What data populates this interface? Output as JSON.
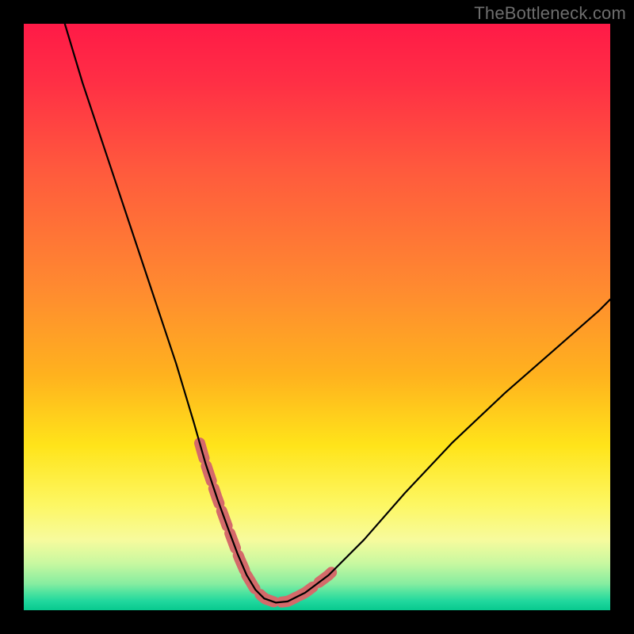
{
  "watermark": {
    "text": "TheBottleneck.com"
  },
  "gradient_stops": [
    "#ff1a47",
    "#ff2f45",
    "#ff5a3d",
    "#ff8a30",
    "#ffb21e",
    "#ffe41a",
    "#fdf763",
    "#f7fb9d",
    "#c8f8a0",
    "#86eda0",
    "#4fe39f",
    "#1fd79d",
    "#08c98e"
  ],
  "chart_data": {
    "type": "line",
    "title": "",
    "xlabel": "",
    "ylabel": "",
    "xlim": [
      0,
      100
    ],
    "ylim": [
      0,
      100
    ],
    "series": [
      {
        "name": "bottleneck-curve",
        "x": [
          7,
          10,
          14,
          18,
          22,
          26,
          29,
          31,
          33,
          35,
          36.5,
          38,
          39.5,
          41,
          43,
          45,
          48,
          52,
          58,
          65,
          73,
          82,
          90,
          98,
          100
        ],
        "values": [
          100,
          90,
          78,
          66,
          54,
          42,
          32,
          25,
          19,
          13.5,
          9.5,
          6,
          3.5,
          2,
          1.3,
          1.5,
          3,
          6,
          12,
          20,
          28.5,
          37,
          44,
          51,
          53
        ]
      }
    ],
    "highlight_segments": [
      {
        "name": "left-dash",
        "x_range": [
          30,
          38
        ],
        "side": "left"
      },
      {
        "name": "bottom-dash",
        "x_range": [
          38,
          47
        ],
        "side": "bottom"
      },
      {
        "name": "right-dash",
        "x_range": [
          47,
          52.5
        ],
        "side": "right"
      }
    ],
    "notes": "Curve is a qualitative V-shape; x has no visible ticks so values are percent-of-width estimates. y read as percent-of-height from bottom (0) to top (100)."
  }
}
